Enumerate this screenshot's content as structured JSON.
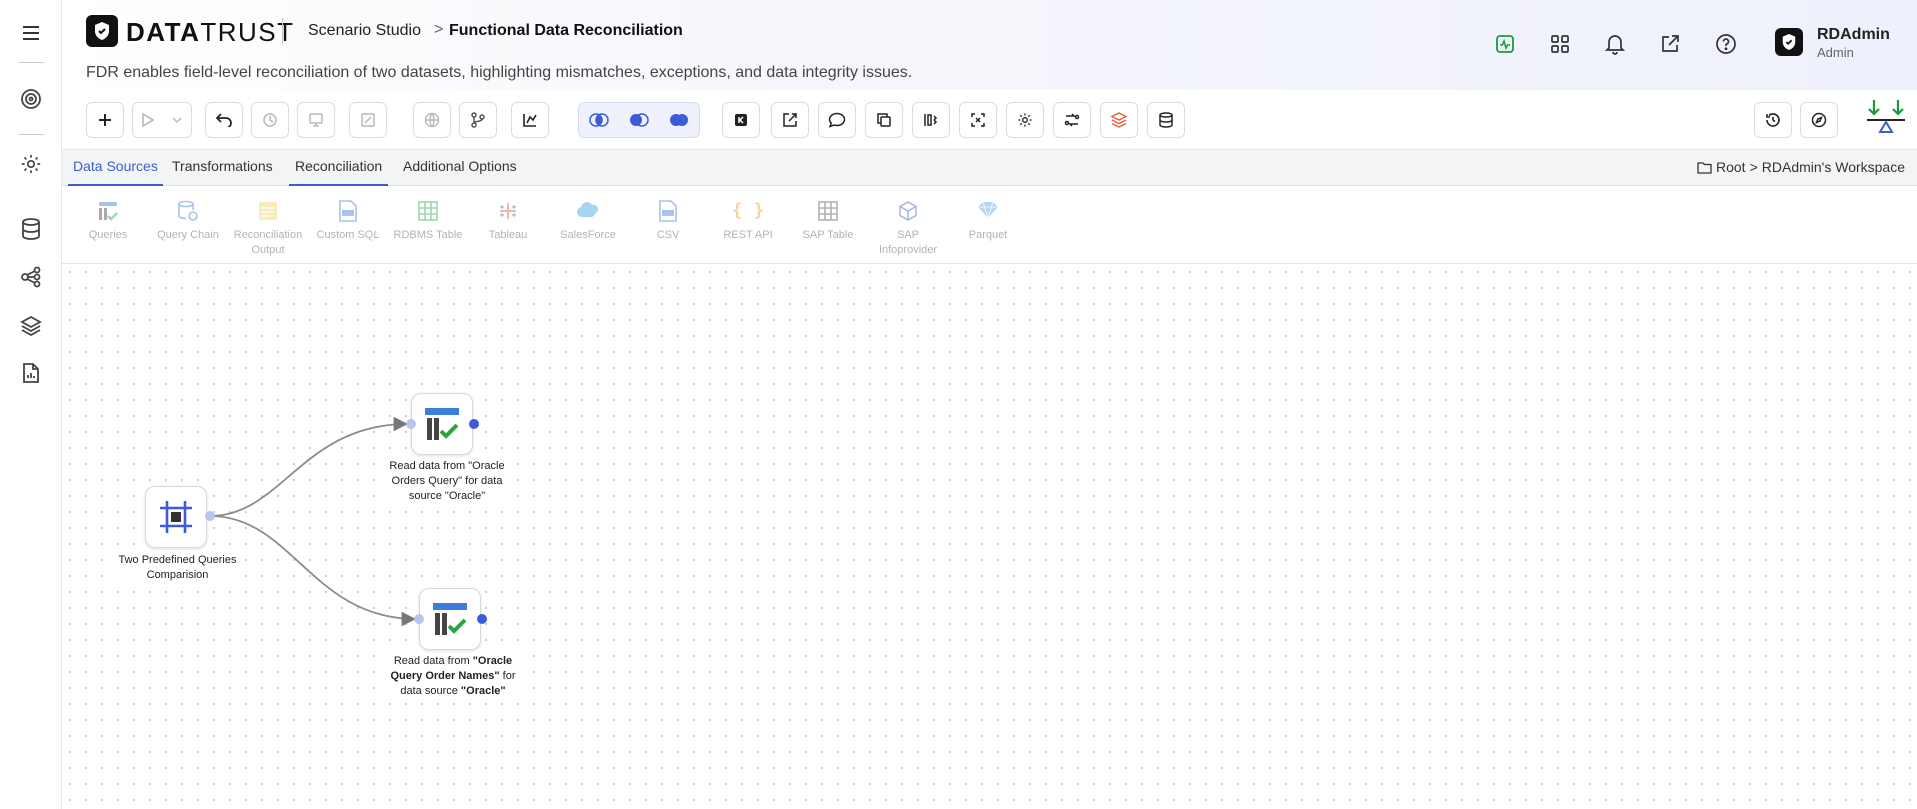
{
  "sidebar": {
    "items": [
      "menu-icon",
      "target-icon",
      "gear-icon",
      "database-icon",
      "hierarchy-icon",
      "layers-icon",
      "report-icon"
    ]
  },
  "header": {
    "brand_bold": "DATA",
    "brand_rest": "TRUST",
    "breadcrumb_parent": "Scenario Studio",
    "breadcrumb_sep": ">",
    "page_title": "Functional Data Reconciliation",
    "description": "FDR enables field-level reconciliation of two datasets, highlighting mismatches, exceptions, and data integrity issues.",
    "user_name": "RDAdmin",
    "user_role": "Admin",
    "accent": "#3a5fcd",
    "green": "#1a9b3b"
  },
  "tabs": [
    {
      "label": "Data Sources"
    },
    {
      "label": "Transformations"
    },
    {
      "label": "Reconciliation"
    },
    {
      "label": "Additional Options"
    }
  ],
  "workspace": {
    "root": "Root",
    "sep": ">",
    "name": "RDAdmin's Workspace"
  },
  "palette": [
    {
      "label": "Queries"
    },
    {
      "label": "Query Chain"
    },
    {
      "label": "Reconciliation Output"
    },
    {
      "label": "Custom SQL"
    },
    {
      "label": "RDBMS Table"
    },
    {
      "label": "Tableau"
    },
    {
      "label": "SalesForce"
    },
    {
      "label": "CSV"
    },
    {
      "label": "REST API"
    },
    {
      "label": "SAP Table"
    },
    {
      "label": "SAP Infoprovider"
    },
    {
      "label": "Parquet"
    }
  ],
  "nodes": {
    "root": {
      "label": "Two Predefined Queries Comparision"
    },
    "q1": {
      "label": "Read data from \"Oracle Orders Query\" for data source \"Oracle\""
    },
    "q2": {
      "pre": "Read data from ",
      "b1": "\"Oracle Query Order Names\"",
      "mid": " for data source ",
      "b2": "\"Oracle\""
    }
  }
}
